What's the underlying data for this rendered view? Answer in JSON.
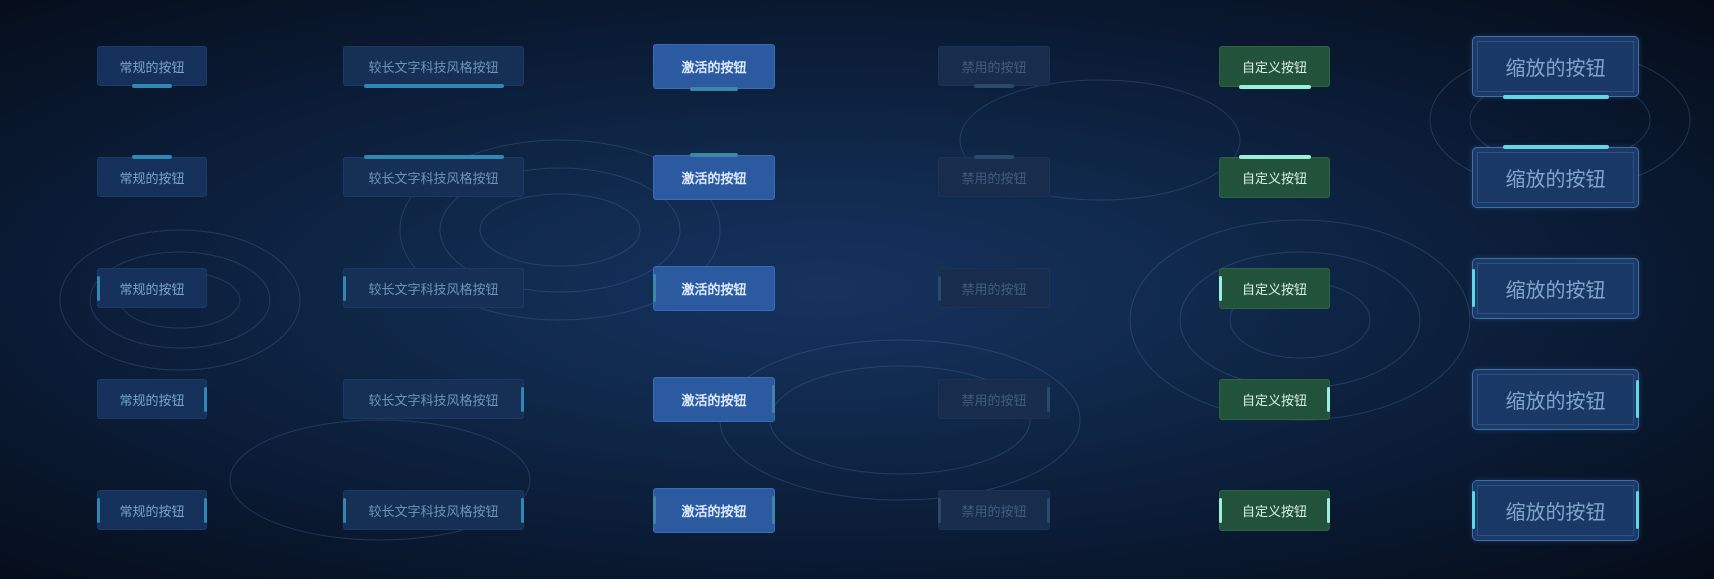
{
  "labels": {
    "normal": "常规的按钮",
    "long": "较长文字科技风格按钮",
    "active": "激活的按钮",
    "disabled": "禁用的按钮",
    "custom": "自定义按钮",
    "scale": "缩放的按钮"
  },
  "columns": [
    "normal",
    "long",
    "active",
    "disabled",
    "custom",
    "scale"
  ],
  "indicator_positions": [
    "bottom",
    "top",
    "left",
    "right",
    "left-right"
  ],
  "colors": {
    "background": "#0f2748",
    "normal_text": "#7aa6c9",
    "active_fill": "#2c5aa0",
    "disabled_text": "#415c80",
    "custom_fill": "#23523a",
    "custom_indicator": "#9af0d8",
    "scale_indicator": "#62d6e3"
  }
}
